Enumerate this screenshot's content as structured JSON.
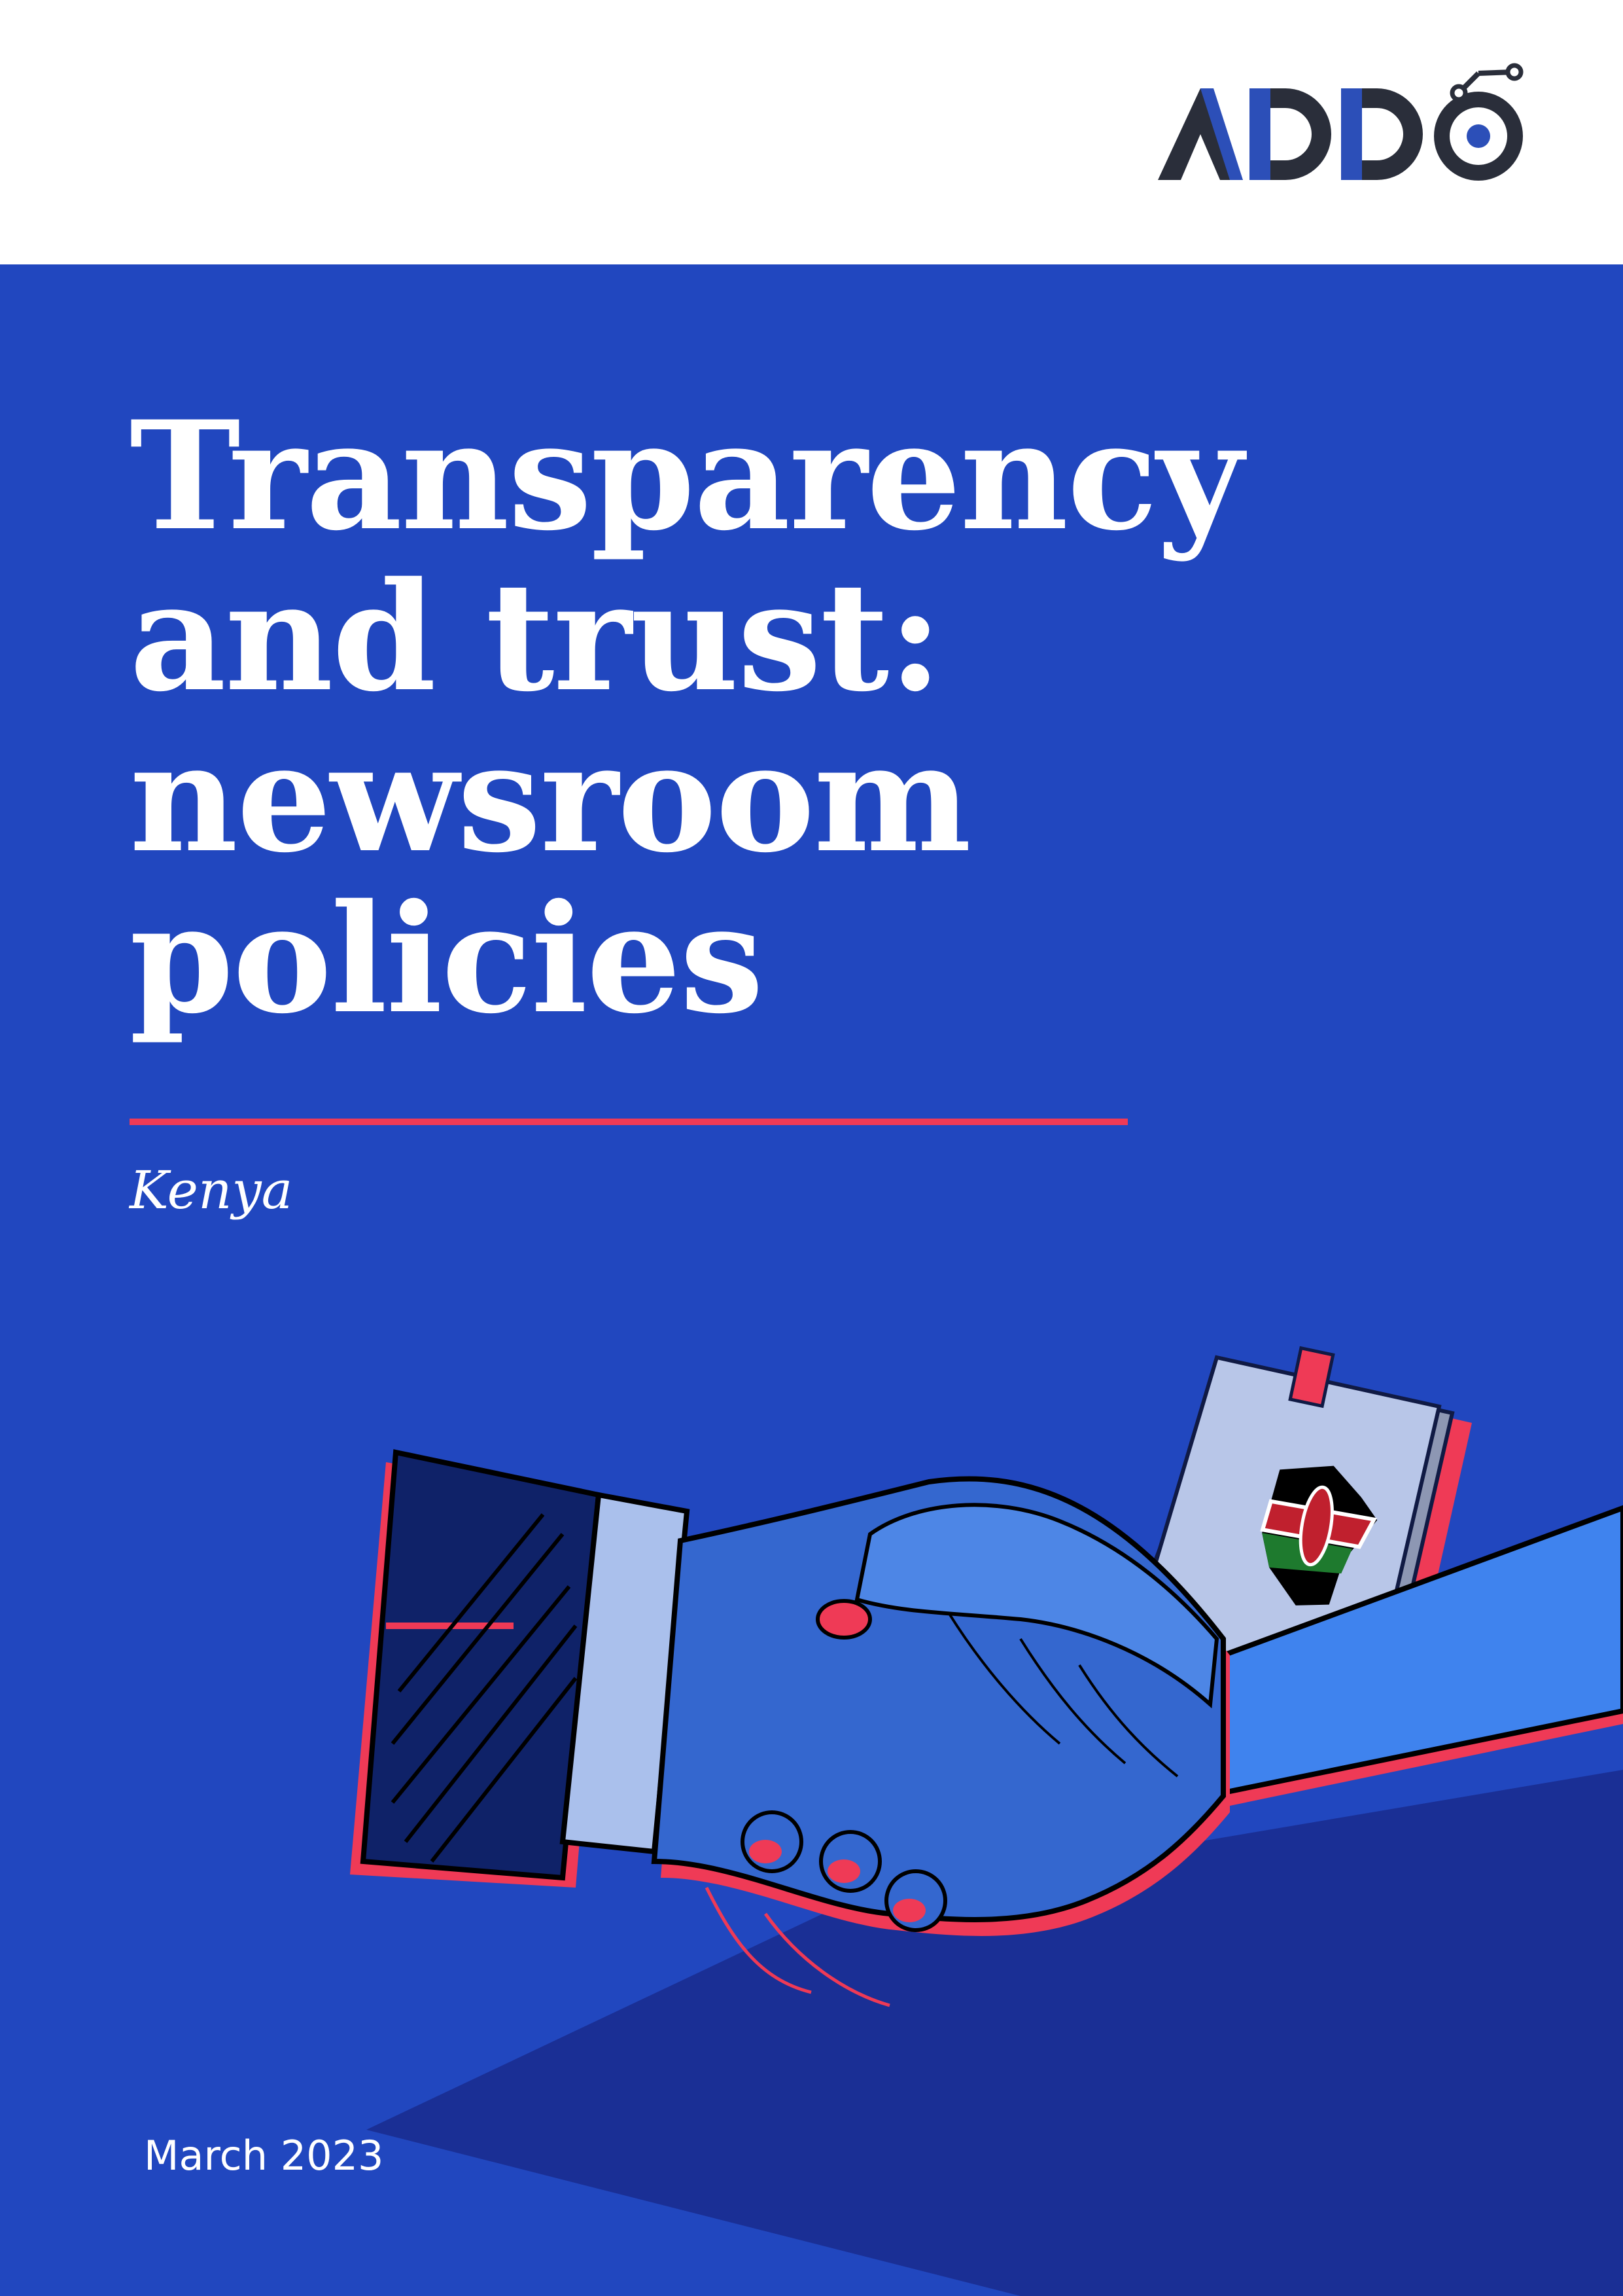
{
  "brand": {
    "logo_text": "ADDO"
  },
  "cover": {
    "title_lines": [
      "Transparency",
      "and trust:",
      "newsroom",
      "policies"
    ],
    "country": "Kenya",
    "date": "March 2023"
  },
  "colors": {
    "background_blue": "#2147bf",
    "accent_red": "#ef3a56",
    "logo_dark": "#2a2e3a",
    "logo_blue": "#2c4fb8"
  },
  "illustration": {
    "main_icon": "handshake-icon",
    "badge_icon": "kenya-flag-map-icon"
  }
}
